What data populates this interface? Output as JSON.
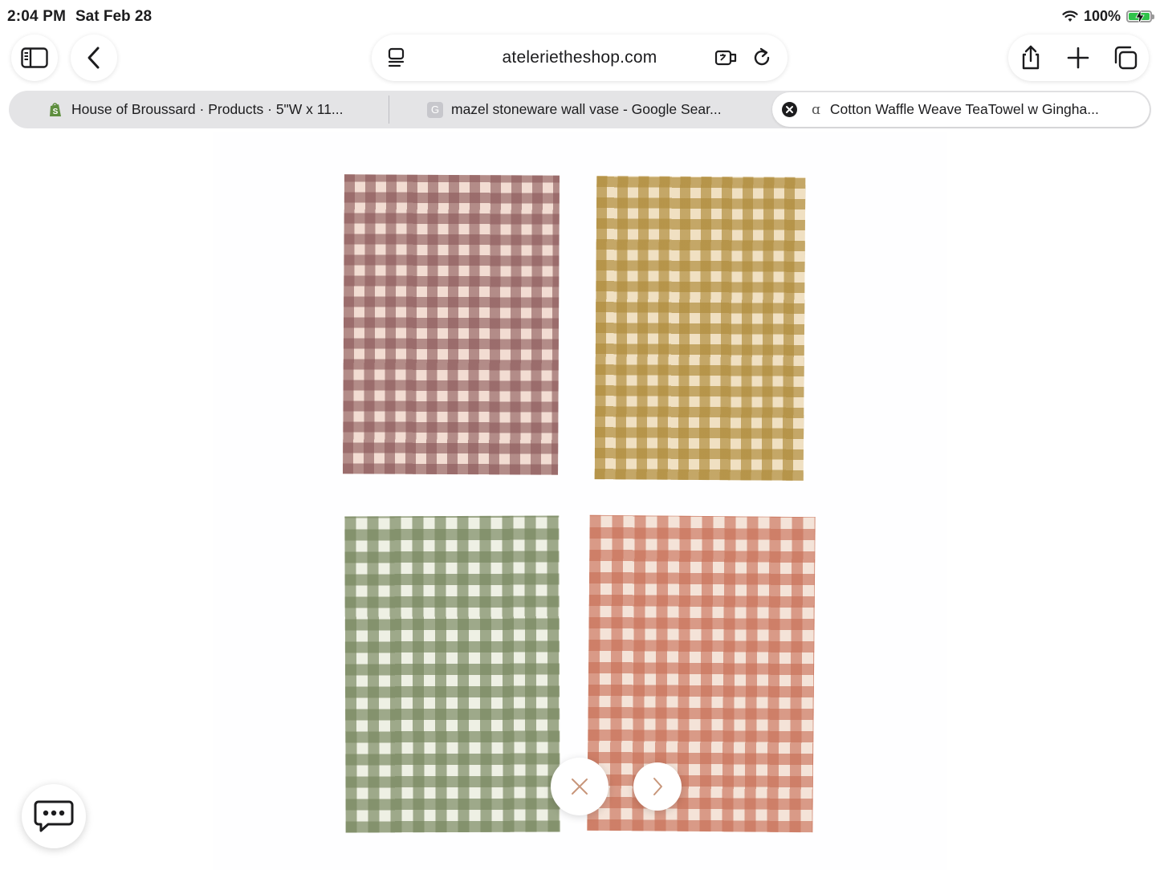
{
  "status_bar": {
    "time": "2:04 PM",
    "date": "Sat Feb 28",
    "battery_percent": "100%"
  },
  "toolbar": {
    "address": "atelerietheshop.com"
  },
  "tabs": [
    {
      "title": "House of Broussard · Products · 5\"W x 11...",
      "favicon": "shopify-icon",
      "active": false
    },
    {
      "title": "mazel stoneware wall vase - Google Sear...",
      "favicon": "google-icon",
      "favicon_letter": "G",
      "active": false
    },
    {
      "title": "Cotton Waffle Weave TeaTowel w Gingha...",
      "favicon": "atelerie-icon",
      "favicon_letter": "ɑ",
      "active": true
    }
  ],
  "gallery": {
    "towels": [
      {
        "name": "mauve-gingham-towel",
        "color": "#8c5a5a"
      },
      {
        "name": "mustard-gingham-towel",
        "color": "#b08c3c"
      },
      {
        "name": "sage-gingham-towel",
        "color": "#78875f"
      },
      {
        "name": "terracotta-gingham-towel",
        "color": "#c86e55"
      }
    ],
    "accent_color": "#c8967a"
  },
  "colors": {
    "battery_green": "#30c24a",
    "tab_strip": "#e4e4e6"
  }
}
